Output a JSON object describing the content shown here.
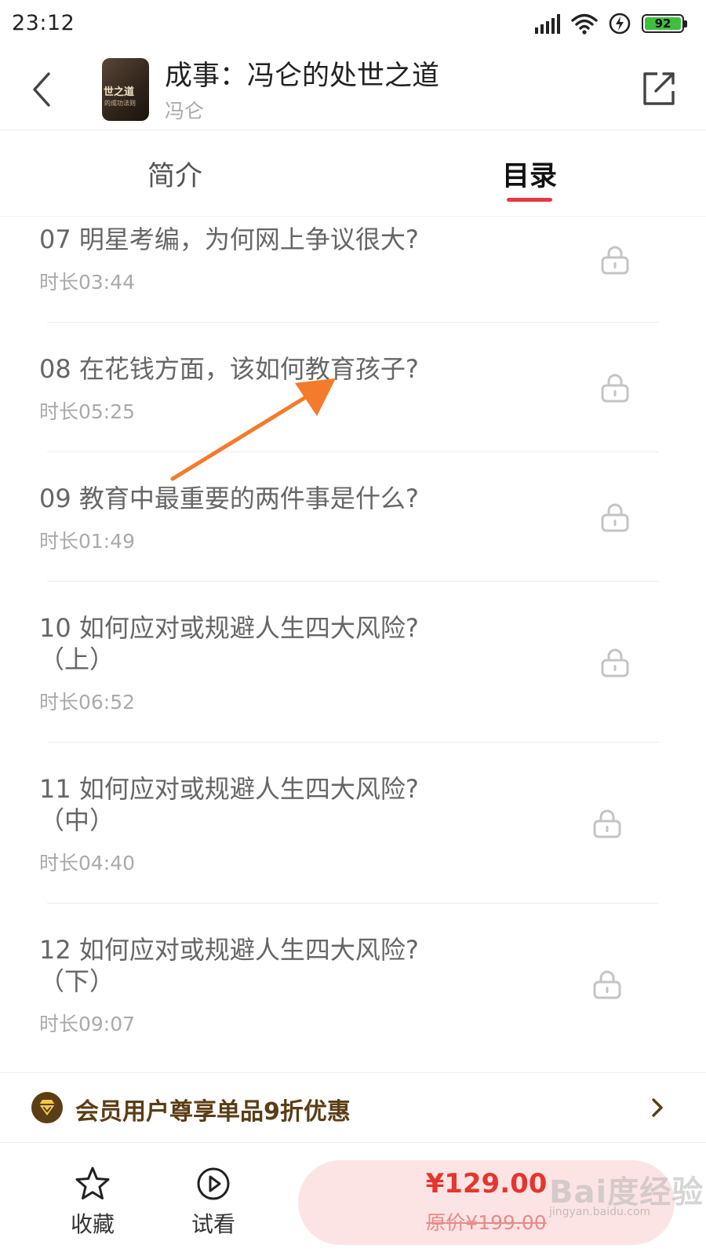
{
  "status_bar": {
    "time": "23:12",
    "battery": "92"
  },
  "header": {
    "title": "成事：冯仑的处世之道",
    "author": "冯仑",
    "cover_text": "世之道",
    "cover_subtext": "的成功法则"
  },
  "tabs": [
    {
      "label": "简介"
    },
    {
      "label": "目录"
    }
  ],
  "list": [
    {
      "title": "07 明星考编，为何网上争议很大?",
      "subtitle": "",
      "duration": "时长03:44"
    },
    {
      "title": "08 在花钱方面，该如何教育孩子?",
      "subtitle": "",
      "duration": "时长05:25"
    },
    {
      "title": "09 教育中最重要的两件事是什么?",
      "subtitle": "",
      "duration": "时长01:49"
    },
    {
      "title": "10 如何应对或规避人生四大风险?",
      "subtitle": "（上）",
      "duration": "时长06:52"
    },
    {
      "title": "11 如何应对或规避人生四大风险?",
      "subtitle": "（中）",
      "duration": "时长04:40"
    },
    {
      "title": "12 如何应对或规避人生四大风险?",
      "subtitle": "（下）",
      "duration": "时长09:07"
    }
  ],
  "promo": {
    "text": "会员用户尊享单品9折优惠"
  },
  "bottom": {
    "favorite_label": "收藏",
    "trial_label": "试看",
    "price": "¥129.00",
    "original_price": "原价¥199.00"
  },
  "watermark": {
    "text": "Bai度经验",
    "sub": "jingyan.baidu.com"
  },
  "colors": {
    "accent": "#e8383d",
    "promo_text": "#5b3d16",
    "buy_bg": "#fde4e4",
    "annotation_arrow": "#f47a2c"
  }
}
